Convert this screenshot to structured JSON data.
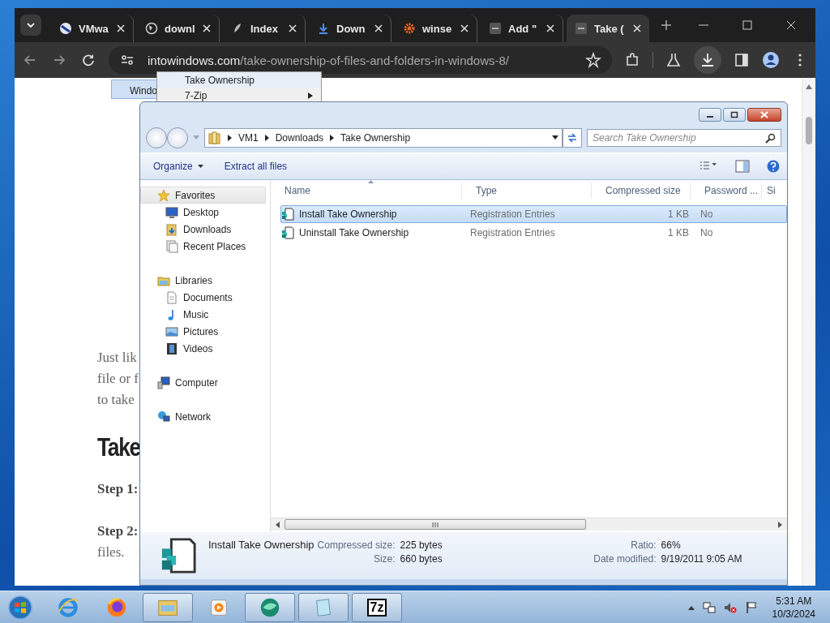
{
  "browser": {
    "tabs": [
      {
        "title": "VMwa",
        "selected": false
      },
      {
        "title": "downl",
        "selected": false
      },
      {
        "title": "Index",
        "selected": false
      },
      {
        "title": "Down",
        "selected": false
      },
      {
        "title": "winse",
        "selected": false
      },
      {
        "title": "Add \"",
        "selected": false
      },
      {
        "title": "Take (",
        "selected": true
      }
    ],
    "address": {
      "domain": "intowindows.com",
      "path": "/take-ownership-of-files-and-folders-in-windows-8/"
    }
  },
  "page": {
    "context_menu": {
      "item": "Windo",
      "entries": [
        {
          "label": "Take Ownership",
          "submenu": false
        },
        {
          "label": "7-Zip",
          "submenu": true
        }
      ]
    },
    "paragraph_lines": [
      "Just lik",
      "file or f",
      "to take"
    ],
    "heading": "Take",
    "steps": [
      {
        "label": "Step 1:"
      },
      {
        "label": "Step 2:",
        "continuation": "files."
      }
    ]
  },
  "explorer": {
    "breadcrumb": [
      "VM1",
      "Downloads",
      "Take Ownership"
    ],
    "search": {
      "placeholder": "Search Take Ownership"
    },
    "toolbar": [
      {
        "label": "Organize",
        "dropdown": true
      },
      {
        "label": "Extract all files",
        "dropdown": false
      }
    ],
    "nav": [
      {
        "label": "Favorites",
        "selected": true,
        "children": [
          {
            "label": "Desktop"
          },
          {
            "label": "Downloads"
          },
          {
            "label": "Recent Places"
          }
        ]
      },
      {
        "label": "Libraries",
        "selected": false,
        "children": [
          {
            "label": "Documents"
          },
          {
            "label": "Music"
          },
          {
            "label": "Pictures"
          },
          {
            "label": "Videos"
          }
        ]
      },
      {
        "label": "Computer",
        "selected": false
      },
      {
        "label": "Network",
        "selected": false
      }
    ],
    "columns": [
      "Name",
      "Type",
      "Compressed size",
      "Password ...",
      "Si"
    ],
    "rows": [
      {
        "name": "Install Take Ownership",
        "type": "Registration Entries",
        "compressed_size": "1 KB",
        "password": "No",
        "selected": true
      },
      {
        "name": "Uninstall Take Ownership",
        "type": "Registration Entries",
        "compressed_size": "1 KB",
        "password": "No",
        "selected": false
      }
    ],
    "details": {
      "name": "Install Take Ownership",
      "fields": [
        {
          "label": "Compressed size:",
          "value": "225 bytes"
        },
        {
          "label": "Ratio:",
          "value": "66%"
        },
        {
          "label": "Size:",
          "value": "660 bytes"
        },
        {
          "label": "Date modified:",
          "value": "9/19/2011 9:05 AM"
        }
      ]
    }
  },
  "taskbar": {
    "items": [
      {
        "running": false
      },
      {
        "running": false
      },
      {
        "running": false
      },
      {
        "running": true
      },
      {
        "running": false
      },
      {
        "running": true
      },
      {
        "running": true
      },
      {
        "running": true,
        "label": "7z"
      }
    ],
    "time": "5:31 AM",
    "date": "10/3/2024"
  }
}
